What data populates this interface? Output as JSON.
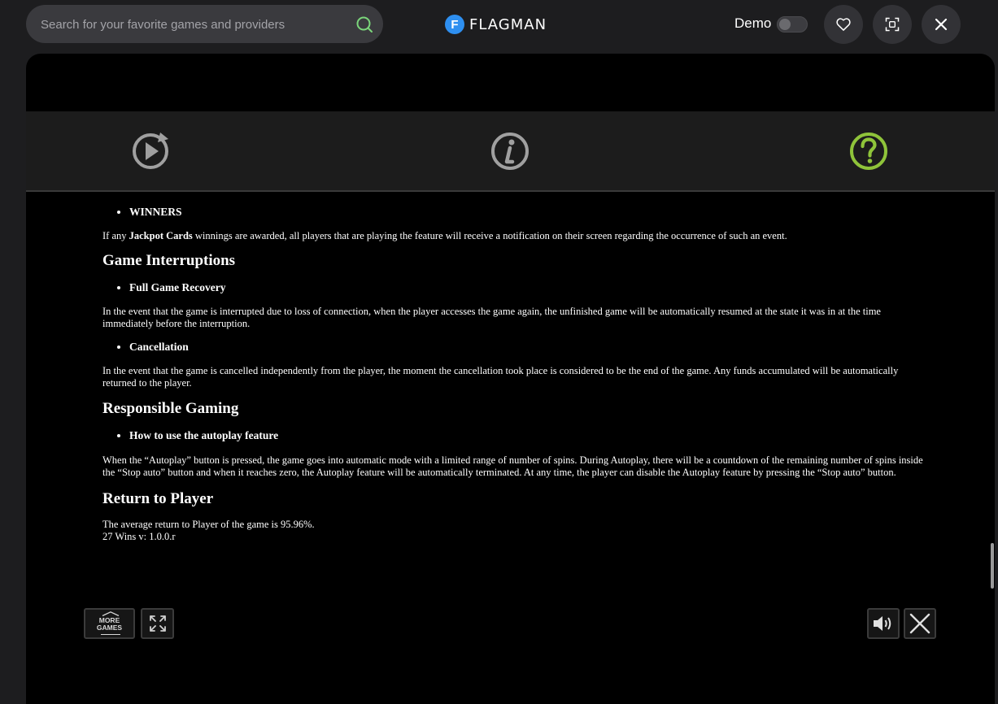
{
  "search": {
    "placeholder": "Search for your favorite games and providers",
    "value": ""
  },
  "logo": {
    "mark": "F",
    "text": "FLAGMAN"
  },
  "header": {
    "demo_label": "Demo",
    "demo_enabled": false
  },
  "icons": {
    "search": "search-icon",
    "favorite": "heart-icon",
    "fullscreen": "fullscreen-icon",
    "close": "close-icon",
    "replay": "replay-icon",
    "info": "info-icon",
    "help": "help-icon",
    "expand": "expand-icon",
    "sound": "speaker-icon"
  },
  "colors": {
    "accent_green": "#8fc43a",
    "logo_blue": "#2e8ff0",
    "search_icon": "#7bd67b"
  },
  "rules": {
    "winners_item": "WINNERS",
    "jackpot_text_before": "If any ",
    "jackpot_bold": "Jackpot Cards",
    "jackpot_text_after": " winnings are awarded, all players that are playing the feature will receive a notification on their screen regarding the occurrence of such an event.",
    "game_interruptions_heading": "Game Interruptions",
    "full_recovery_item": "Full Game Recovery",
    "full_recovery_text": "In the event that the game is interrupted due to loss of connection, when the player accesses the game again, the unfinished game will be automatically resumed at the state it was in at the time immediately before the interruption.",
    "cancellation_item": "Cancellation",
    "cancellation_text": "In the event that the game is cancelled independently from the player, the moment the cancellation took place is considered to be the end of the game. Any funds accumulated will be automatically returned to the player.",
    "responsible_heading": "Responsible Gaming",
    "autoplay_item": "How to use the autoplay feature",
    "autoplay_text": "When the “Autoplay” button is pressed, the game goes into automatic mode with a limited range of number of spins. During Autoplay, there will be a countdown of the remaining number of spins inside the “Stop auto” button and when it reaches zero, the Autoplay feature will be automatically terminated. At any time, the player can disable the Autoplay feature by pressing the “Stop auto” button.",
    "rtp_heading": "Return to Player",
    "rtp_text": "The average return to Player of the game is 95.96%.",
    "version_text": "27 Wins v: 1.0.0.r"
  },
  "game_controls": {
    "more_games_line1": "MORE",
    "more_games_line2": "GAMES"
  }
}
